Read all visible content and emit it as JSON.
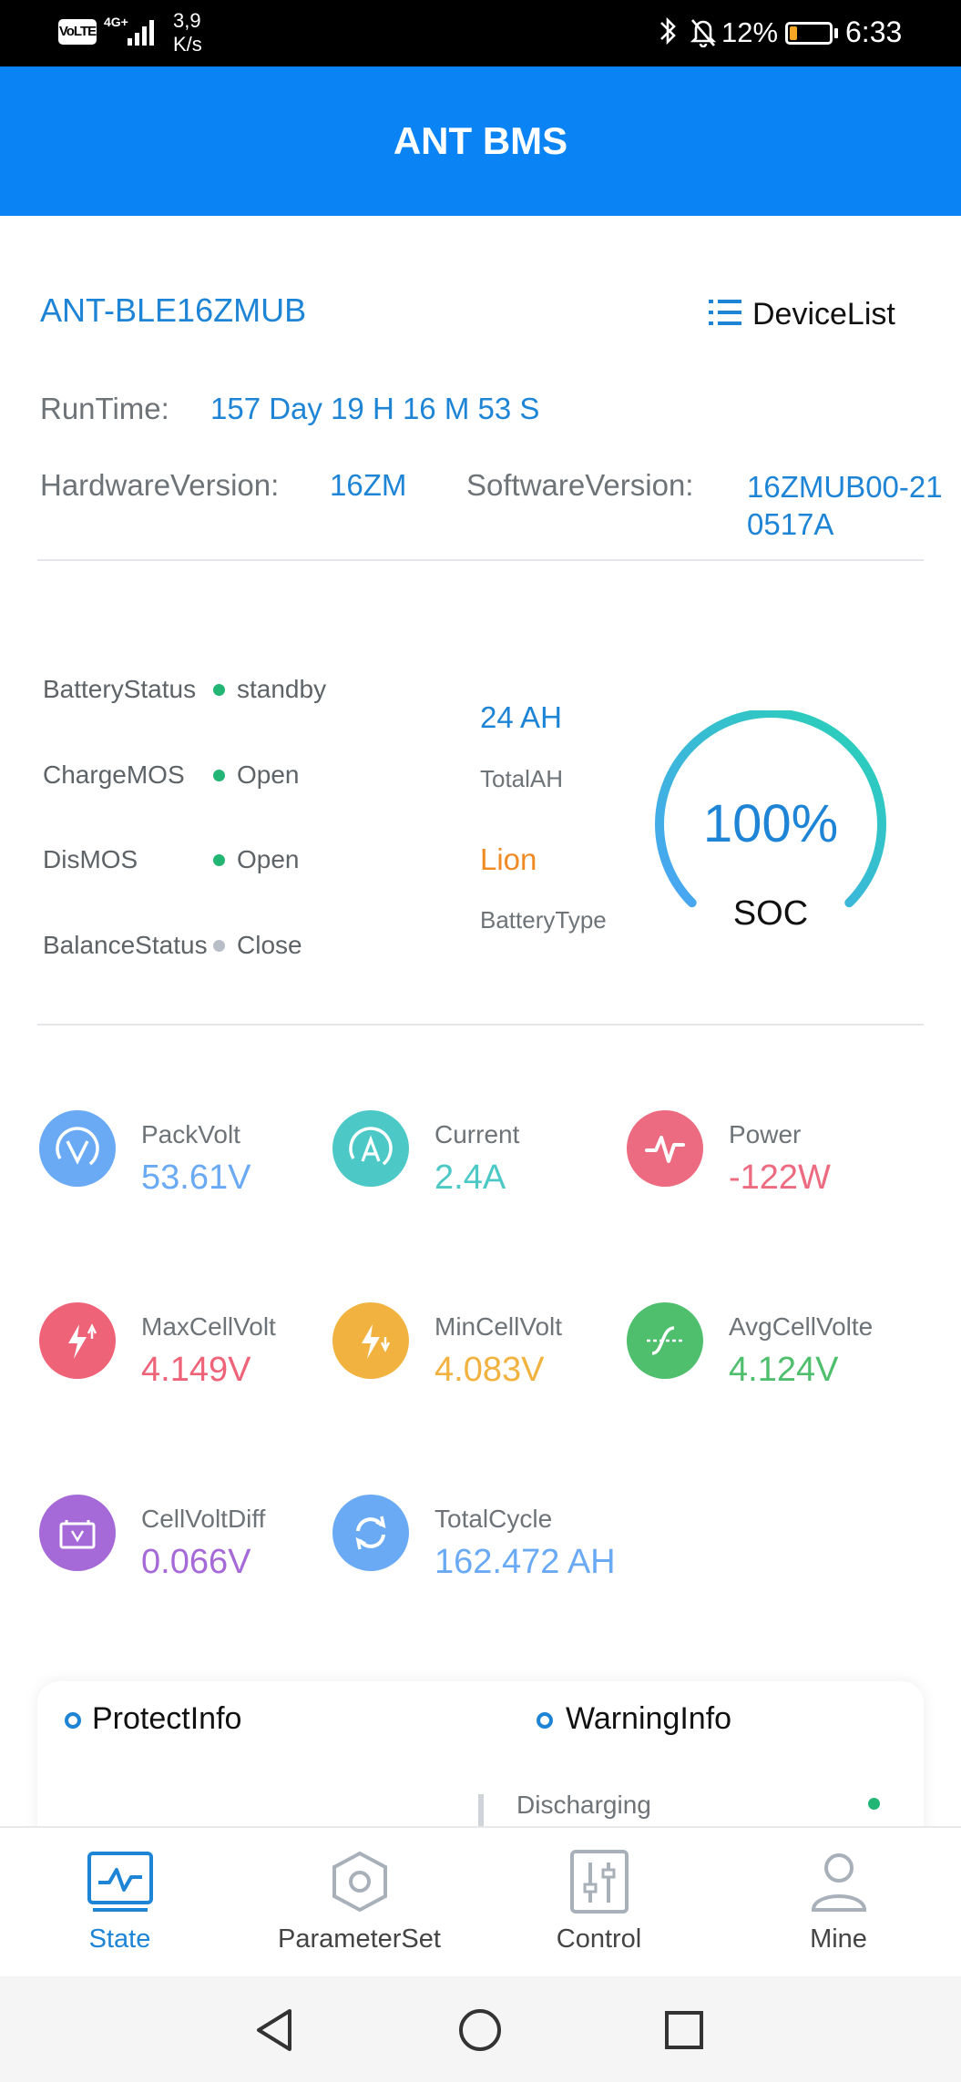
{
  "status_bar": {
    "volte": "VoLTE",
    "network": "4G+",
    "speed_value": "3,9",
    "speed_unit": "K/s",
    "battery_percent": "12%",
    "time": "6:33"
  },
  "header": {
    "title": "ANT BMS"
  },
  "device": {
    "name": "ANT-BLE16ZMUB",
    "device_list_label": "DeviceList",
    "runtime_label": "RunTime:",
    "runtime_value": "157 Day 19 H 16 M 53 S",
    "hardware_label": "HardwareVersion:",
    "hardware_value": "16ZM",
    "software_label": "SoftwareVersion:",
    "software_value_line1": "16ZMUB00-21",
    "software_value_line2": "0517A"
  },
  "status": {
    "items": [
      {
        "label": "BatteryStatus",
        "value": "standby",
        "dot_color": "#22b573"
      },
      {
        "label": "ChargeMOS",
        "value": "Open",
        "dot_color": "#22b573"
      },
      {
        "label": "DisMOS",
        "value": "Open",
        "dot_color": "#22b573"
      },
      {
        "label": "BalanceStatus",
        "value": "Close",
        "dot_color": "#b8bec8"
      }
    ],
    "total_ah_value": "24 AH",
    "total_ah_label": "TotalAH",
    "battery_type_value": "Lion",
    "battery_type_label": "BatteryType",
    "soc_value": "100%",
    "soc_label": "SOC",
    "soc_percent": 100
  },
  "metrics": [
    {
      "label": "PackVolt",
      "value": "53.61V",
      "color": "#6aaaf5",
      "icon": "pack-volt-icon"
    },
    {
      "label": "Current",
      "value": "2.4A",
      "color": "#4cc9c6",
      "icon": "current-icon"
    },
    {
      "label": "Power",
      "value": "-122W",
      "color": "#ec6b80",
      "icon": "power-icon"
    },
    {
      "label": "MaxCellVolt",
      "value": "4.149V",
      "color": "#ef6379",
      "icon": "max-cell-volt-icon"
    },
    {
      "label": "MinCellVolt",
      "value": "4.083V",
      "color": "#f2b23f",
      "icon": "min-cell-volt-icon"
    },
    {
      "label": "AvgCellVolte",
      "value": "4.124V",
      "color": "#4fbf6d",
      "icon": "avg-cell-volt-icon"
    },
    {
      "label": "CellVoltDiff",
      "value": "0.066V",
      "color": "#a66ad8",
      "icon": "cell-volt-diff-icon"
    },
    {
      "label": "TotalCycle",
      "value": "162.472 AH",
      "color": "#6aaaf5",
      "icon": "total-cycle-icon"
    }
  ],
  "info_card": {
    "protect_title": "ProtectInfo",
    "warning_title": "WarningInfo",
    "warning_item": "Discharging"
  },
  "bottom_nav": [
    {
      "label": "State",
      "active": true
    },
    {
      "label": "ParameterSet",
      "active": false
    },
    {
      "label": "Control",
      "active": false
    },
    {
      "label": "Mine",
      "active": false
    }
  ],
  "colors": {
    "primary": "#0a84f5",
    "accent_blue": "#1d84d6",
    "orange": "#f08a24",
    "gauge_start": "#4aa3f5",
    "gauge_end": "#27d3b4"
  }
}
